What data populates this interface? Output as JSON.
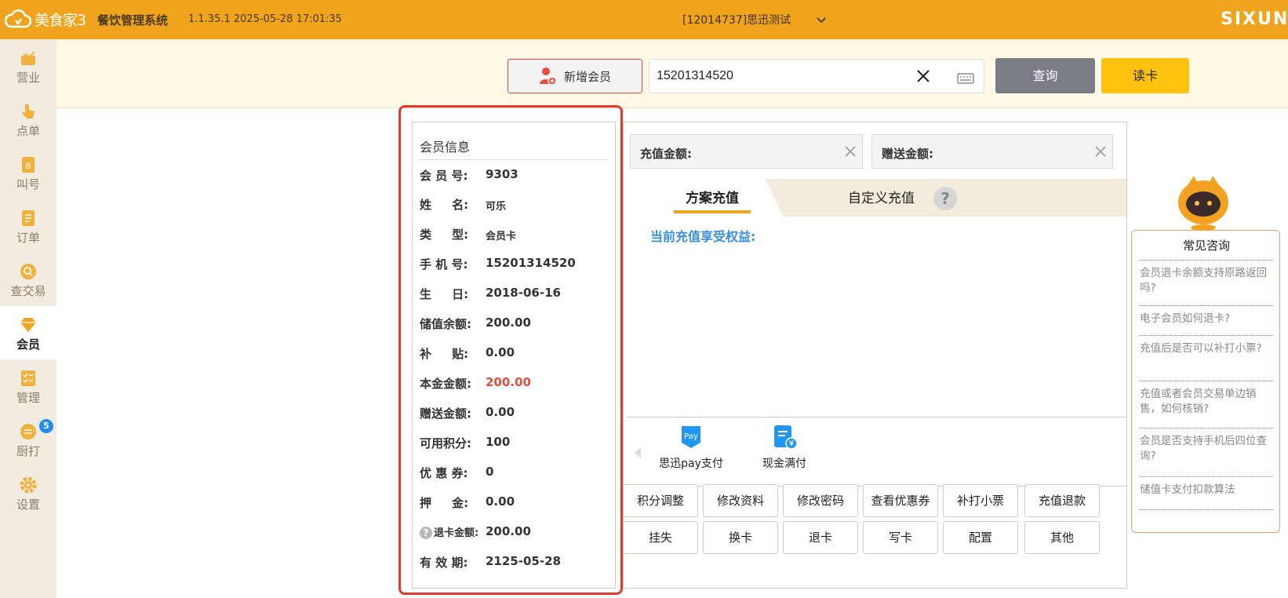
{
  "header": {
    "logo_text": "美食家3",
    "system_title": "餐饮管理系统",
    "version": "1.1.35.1 2025-05-28 17:01:35",
    "store": "[12014737]思迅测试",
    "brand": "SIXUN"
  },
  "sidebar": {
    "items": [
      {
        "label": "营业",
        "icon": "shop-icon"
      },
      {
        "label": "点单",
        "icon": "hand-pointer-icon"
      },
      {
        "label": "叫号",
        "icon": "number-ticket-icon"
      },
      {
        "label": "订单",
        "icon": "order-list-icon"
      },
      {
        "label": "查交易",
        "icon": "search-transaction-icon"
      },
      {
        "label": "会员",
        "icon": "diamond-icon"
      },
      {
        "label": "管理",
        "icon": "checklist-icon"
      },
      {
        "label": "厨打",
        "icon": "kitchen-print-icon",
        "badge": "5"
      },
      {
        "label": "设置",
        "icon": "gear-icon"
      }
    ],
    "active": "会员"
  },
  "toolbar": {
    "add_member_label": "新增会员",
    "search_value": "15201314520",
    "query_label": "查询",
    "read_card_label": "读卡"
  },
  "member": {
    "title": "会员信息",
    "fields": [
      {
        "key": "会 员 号:",
        "value": "9303"
      },
      {
        "key": "姓     名:",
        "value": "可乐"
      },
      {
        "key": "类     型:",
        "value": "会员卡"
      },
      {
        "key": "手 机 号:",
        "value": "15201314520"
      },
      {
        "key": "生     日:",
        "value": "2018-06-16"
      },
      {
        "key": "储值余额:",
        "value": "200.00"
      },
      {
        "key": "补     贴:",
        "value": "0.00"
      },
      {
        "key": "本金金额:",
        "value": "200.00"
      },
      {
        "key": "赠送金额:",
        "value": "0.00"
      },
      {
        "key": "可用积分:",
        "value": "100"
      },
      {
        "key": "优 惠 券:",
        "value": "0"
      },
      {
        "key": "押     金:",
        "value": "0.00"
      },
      {
        "key": "退卡金额:",
        "value": "200.00"
      },
      {
        "key": "有 效 期:",
        "value": "2125-05-28"
      }
    ],
    "accent_red": "#e84c3d"
  },
  "recharge": {
    "amount_label": "充值金额:",
    "gift_label": "赠送金额:",
    "tab_plan": "方案充值",
    "tab_custom": "自定义充值",
    "help_symbol": "?",
    "benefit_label": "当前充值享受权益:",
    "pay_methods": [
      {
        "label": "思迅pay支付",
        "icon": "pay-icon"
      },
      {
        "label": "现金满付",
        "icon": "cash-receipt-icon"
      }
    ],
    "pay_icon_text": "Pay",
    "actions_row1": [
      "积分调整",
      "修改资料",
      "修改密码",
      "查看优惠券",
      "补打小票",
      "充值退款"
    ],
    "actions_row2": [
      "挂失",
      "换卡",
      "退卡",
      "写卡",
      "配置",
      "其他"
    ]
  },
  "faq": {
    "title": "常见咨询",
    "items": [
      "会员退卡余额支持原路返回吗?",
      "电子会员如何退卡?",
      "充值后是否可以补打小票?",
      "充值或者会员交易单边销售，如何核销?",
      "会员是否支持手机后四位查询?",
      "储值卡支付扣款算法"
    ]
  },
  "colors": {
    "header_bg": "#f0a31c",
    "highlight_border": "#e23a2e",
    "query_btn": "#7a7d86",
    "read_btn": "#ffc20e",
    "benefit_text": "#3a8fd9"
  }
}
